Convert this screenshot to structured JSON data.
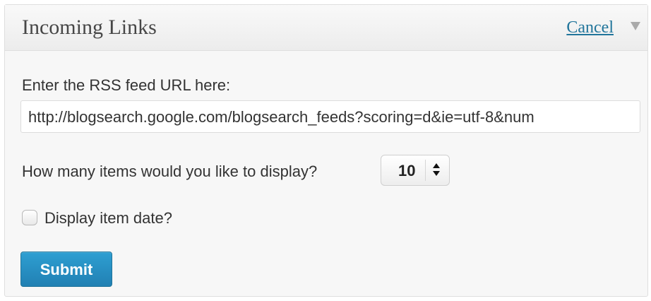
{
  "widget": {
    "title": "Incoming Links",
    "cancel_label": "Cancel",
    "toggle_icon": "triangle-down-icon"
  },
  "form": {
    "feed_url_label": "Enter the RSS feed URL here:",
    "feed_url_value": "http://blogsearch.google.com/blogsearch_feeds?scoring=d&ie=utf-8&num",
    "items_label": "How many items would you like to display?",
    "items_selected": "10",
    "show_date_label": "Display item date?",
    "show_date_checked": false,
    "submit_label": "Submit"
  },
  "colors": {
    "link": "#21759b",
    "primary_button": "#2180b3",
    "panel_bg": "#f7f7f7"
  }
}
